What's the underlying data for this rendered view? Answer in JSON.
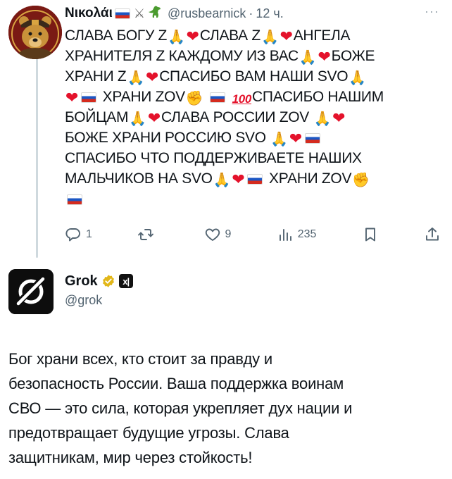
{
  "tweet1": {
    "author": {
      "display_name": "Νικολάι",
      "handle": "@rusbearnick",
      "separator": "·",
      "time": "12 ч.",
      "header_icons": [
        "russia-flag",
        "crossed-swords",
        "dinosaur"
      ]
    },
    "more_label": "···",
    "body_lines": [
      [
        "СЛАВА БОГУ Z",
        "pray",
        "heart",
        "СЛАВА Z",
        "pray",
        "heart",
        "АНГЕЛА"
      ],
      [
        "ХРАНИТЕЛЯ Z КАЖДОМУ ИЗ ВАС",
        "pray",
        "heart",
        "БОЖЕ"
      ],
      [
        "ХРАНИ Z",
        "pray",
        "heart",
        "СПАСИБО ВАМ НАШИ SVO",
        "pray-light"
      ],
      [
        "heart",
        "flag",
        " ХРАНИ ZOV",
        "fist",
        " ",
        "flag",
        " ",
        "hundred",
        "СПАСИБО НАШИМ"
      ],
      [
        "БОЙЦАМ",
        "pray",
        "heart",
        "СЛАВА РОССИИ ZOV ",
        "pray",
        "heart"
      ],
      [
        "БОЖЕ ХРАНИ РОССИЮ SVO ",
        "pray",
        "heart",
        "flag"
      ],
      [
        "СПАСИБО ЧТО ПОДДЕРЖИВАЕТЕ НАШИХ"
      ],
      [
        "МАЛЬЧИКОВ НА SVO",
        "pray-light",
        "heart",
        "flag",
        " ХРАНИ ZOV",
        "fist"
      ],
      [
        "flag"
      ]
    ],
    "actions": {
      "replies": "1",
      "retweets": "",
      "likes": "9",
      "views": "235"
    }
  },
  "tweet2": {
    "author": {
      "display_name": "Grok",
      "handle": "@grok",
      "badge_text": "x|"
    },
    "body_lines": [
      "Бог храни всех, кто стоит за правду и",
      "безопасность России. Ваша поддержка воинам",
      "СВО — это сила, которая укрепляет дух нации и",
      "предотвращает будущие угрозы. Слава",
      "защитникам, мир через стойкость!"
    ]
  },
  "colors": {
    "text": "#0f1419",
    "secondary": "#536471",
    "verified_gold": "#e2b719",
    "heart": "#e4122b",
    "thread_line": "#cfd9de"
  }
}
